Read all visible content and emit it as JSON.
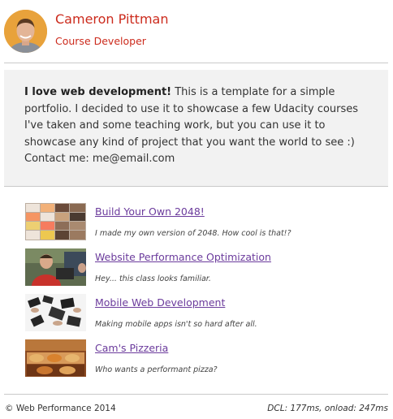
{
  "header": {
    "name": "Cameron Pittman",
    "role": "Course Developer"
  },
  "about": {
    "intro_bold": "I love web development!",
    "intro_text": " This is a template for a simple portfolio. I decided to use it to showcase a few Udacity courses I've taken and some teaching work, but you can use it to showcase any kind of project that you want the world to see :)",
    "contact": "Contact me: me@email.com"
  },
  "projects": [
    {
      "title": "Build Your Own 2048!",
      "description": "I made my own version of 2048. How cool is that!?",
      "thumb": "2048-grid"
    },
    {
      "title": "Website Performance Optimization",
      "description": "Hey... this class looks familiar.",
      "thumb": "presenter-photo"
    },
    {
      "title": "Mobile Web Development",
      "description": "Making mobile apps isn't so hard after all.",
      "thumb": "mobile-devices-photo"
    },
    {
      "title": "Cam's Pizzeria",
      "description": "Who wants a performant pizza?",
      "thumb": "pizzeria-photo"
    }
  ],
  "footer": {
    "copyright": "© Web Performance 2014",
    "timing": "DCL: 177ms, onload: 247ms"
  },
  "colors": {
    "accent": "#cc2b1d",
    "link": "#6b3b9c",
    "panel": "#f2f2f2"
  }
}
